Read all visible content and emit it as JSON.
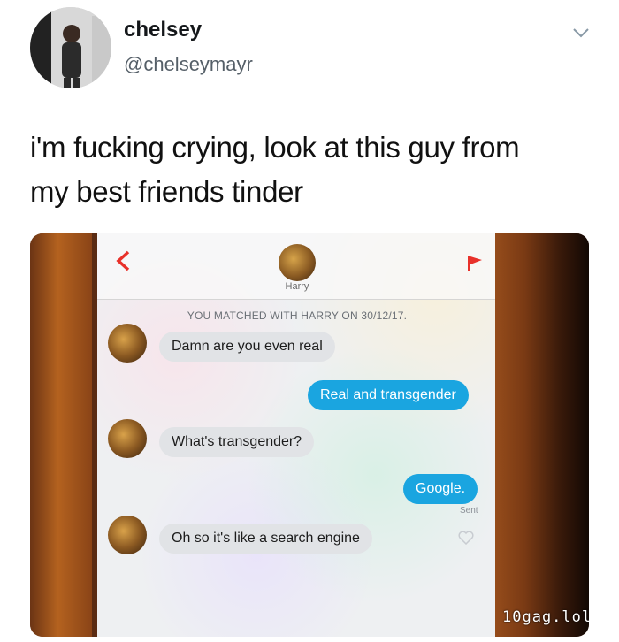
{
  "tweet": {
    "display_name": "chelsey",
    "handle": "@chelseymayr",
    "text_line1": "i'm fucking crying, look at this guy from",
    "text_line2": "my best friends tinder",
    "icons": {
      "avatar": "profile-photo",
      "menu": "chevron-down-icon"
    }
  },
  "photo": {
    "header": {
      "match_name": "Harry",
      "icons": {
        "back": "back-chevron-icon",
        "report": "flag-icon",
        "match_avatar": "match-avatar"
      }
    },
    "match_note": "YOU MATCHED WITH HARRY ON 30/12/17.",
    "messages": [
      {
        "from": "them",
        "text": "Damn are you even real"
      },
      {
        "from": "me",
        "text": "Real and transgender"
      },
      {
        "from": "them",
        "text": "What's transgender?"
      },
      {
        "from": "me",
        "text": "Google."
      },
      {
        "from": "them",
        "text": "Oh so it's like a search engine"
      }
    ],
    "sent_label": "Sent",
    "watermark": "10gag.lol"
  },
  "colors": {
    "outgoing_bubble": "#1aa5e0",
    "incoming_bubble": "#e1e3e6",
    "flag": "#e8312a",
    "back_chevron": "#e8312a"
  }
}
